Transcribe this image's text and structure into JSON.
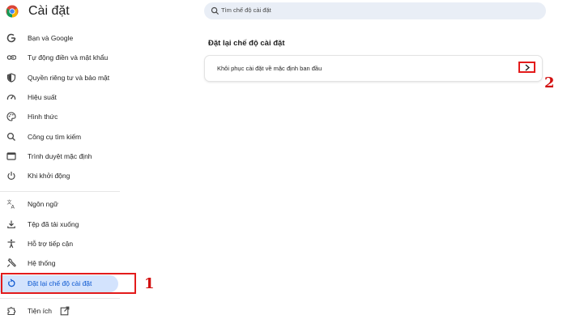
{
  "app": {
    "title": "Cài đặt"
  },
  "search": {
    "placeholder": "Tìm chế độ cài đặt"
  },
  "sidebar": {
    "items": [
      {
        "label": "Bạn và Google",
        "icon": "google-icon"
      },
      {
        "label": "Tự động điền và mật khẩu",
        "icon": "key-icon"
      },
      {
        "label": "Quyền riêng tư và bảo mật",
        "icon": "shield-icon"
      },
      {
        "label": "Hiệu suất",
        "icon": "speedometer-icon"
      },
      {
        "label": "Hình thức",
        "icon": "palette-icon"
      },
      {
        "label": "Công cụ tìm kiếm",
        "icon": "search-icon"
      },
      {
        "label": "Trình duyệt mặc định",
        "icon": "browser-window-icon"
      },
      {
        "label": "Khi khởi động",
        "icon": "power-icon"
      },
      {
        "label": "Ngôn ngữ",
        "icon": "translate-icon"
      },
      {
        "label": "Tệp đã tải xuống",
        "icon": "download-icon"
      },
      {
        "label": "Hỗ trợ tiếp cận",
        "icon": "accessibility-icon"
      },
      {
        "label": "Hệ thống",
        "icon": "wrench-icon"
      },
      {
        "label": "Đặt lại chế độ cài đặt",
        "icon": "reset-icon",
        "active": true
      },
      {
        "label": "Tiện ích",
        "icon": "puzzle-icon",
        "trailing_icon": "external-link-icon"
      }
    ]
  },
  "main": {
    "section_title": "Đặt lại chế độ cài đặt",
    "restore_row": {
      "label": "Khôi phục cài đặt về mặc định ban đầu",
      "icon": "chevron-right-icon"
    }
  },
  "annotations": {
    "step1": "1",
    "step2": "2",
    "color": "#e31b1b"
  },
  "colors": {
    "active_bg": "#d3e3fd",
    "active_text": "#0b57d0",
    "search_bg": "#e9eef6"
  }
}
